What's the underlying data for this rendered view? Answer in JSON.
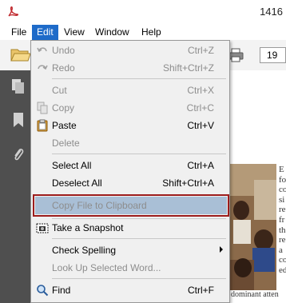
{
  "window": {
    "title": "1416"
  },
  "menubar": {
    "items": [
      "File",
      "Edit",
      "View",
      "Window",
      "Help"
    ]
  },
  "toolbar": {
    "page_number": "19"
  },
  "edit_menu": {
    "undo": {
      "label": "Undo",
      "shortcut": "Ctrl+Z"
    },
    "redo": {
      "label": "Redo",
      "shortcut": "Shift+Ctrl+Z"
    },
    "cut": {
      "label": "Cut",
      "shortcut": "Ctrl+X"
    },
    "copy": {
      "label": "Copy",
      "shortcut": "Ctrl+C"
    },
    "paste": {
      "label": "Paste",
      "shortcut": "Ctrl+V"
    },
    "delete": {
      "label": "Delete"
    },
    "select_all": {
      "label": "Select All",
      "shortcut": "Ctrl+A"
    },
    "deselect_all": {
      "label": "Deselect All",
      "shortcut": "Shift+Ctrl+A"
    },
    "copy_file": {
      "label": "Copy File to Clipboard"
    },
    "snapshot": {
      "label": "Take a Snapshot"
    },
    "check_spelling": {
      "label": "Check Spelling"
    },
    "look_up": {
      "label": "Look Up Selected Word..."
    },
    "find": {
      "label": "Find",
      "shortcut": "Ctrl+F"
    }
  },
  "document": {
    "side_letters": [
      "E",
      "fo",
      "co",
      "si",
      "re",
      "fr",
      "th",
      "re",
      "a",
      "co",
      "ed"
    ],
    "bottom_line": "dominant atten"
  },
  "colors": {
    "menu_highlight": "#1e6bc9",
    "item_highlight": "#a9bfd6",
    "focus_border": "#9c1d1d"
  }
}
